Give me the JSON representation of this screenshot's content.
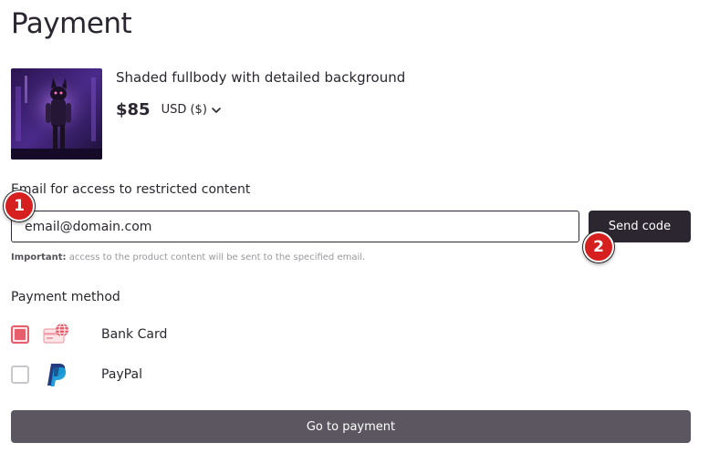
{
  "page": {
    "title": "Payment"
  },
  "product": {
    "name": "Shaded fullbody with detailed background",
    "price": "$85",
    "currency": "USD ($)"
  },
  "email": {
    "label": "Email for access to restricted content",
    "value": "email@domain.com",
    "send_code_label": "Send code",
    "note_prefix": "Important:",
    "note_text": "access to the product content will be sent to the specified email."
  },
  "payment": {
    "label": "Payment method",
    "methods": [
      {
        "label": "Bank Card",
        "selected": true,
        "icon": "bank-card-icon"
      },
      {
        "label": "PayPal",
        "selected": false,
        "icon": "paypal-icon"
      }
    ],
    "submit_label": "Go to payment"
  },
  "markers": [
    "1",
    "2"
  ],
  "colors": {
    "text": "#2b2630",
    "accent": "#e85d6b",
    "button_dark": "#2b2630",
    "button_muted": "#5c5660",
    "marker": "#d61f1f"
  }
}
